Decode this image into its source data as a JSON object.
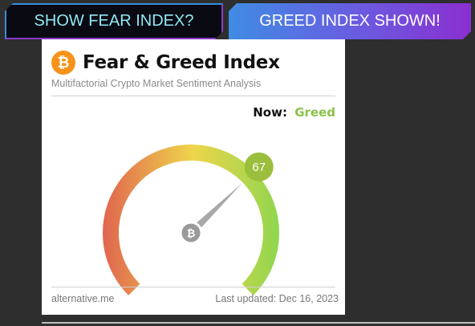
{
  "tabs": {
    "fear_label": "SHOW FEAR INDEX?",
    "greed_label": "GREED INDEX SHOWN!"
  },
  "card": {
    "logo_glyph": "₿",
    "title": "Fear & Greed Index",
    "subtitle": "Multifactorial Crypto Market Sentiment Analysis",
    "now_label": "Now:",
    "now_value": "Greed",
    "index_value": "67",
    "hub_glyph": "₿",
    "source": "alternative.me",
    "last_updated": "Last updated: Dec 16, 2023"
  },
  "gauge": {
    "value": 67,
    "min": 0,
    "max": 100,
    "colors": {
      "fear": "#e0674f",
      "neutral": "#efd54b",
      "greed": "#8ed64f",
      "badge": "#9bbe3c",
      "needle": "#a8a8a8"
    }
  }
}
